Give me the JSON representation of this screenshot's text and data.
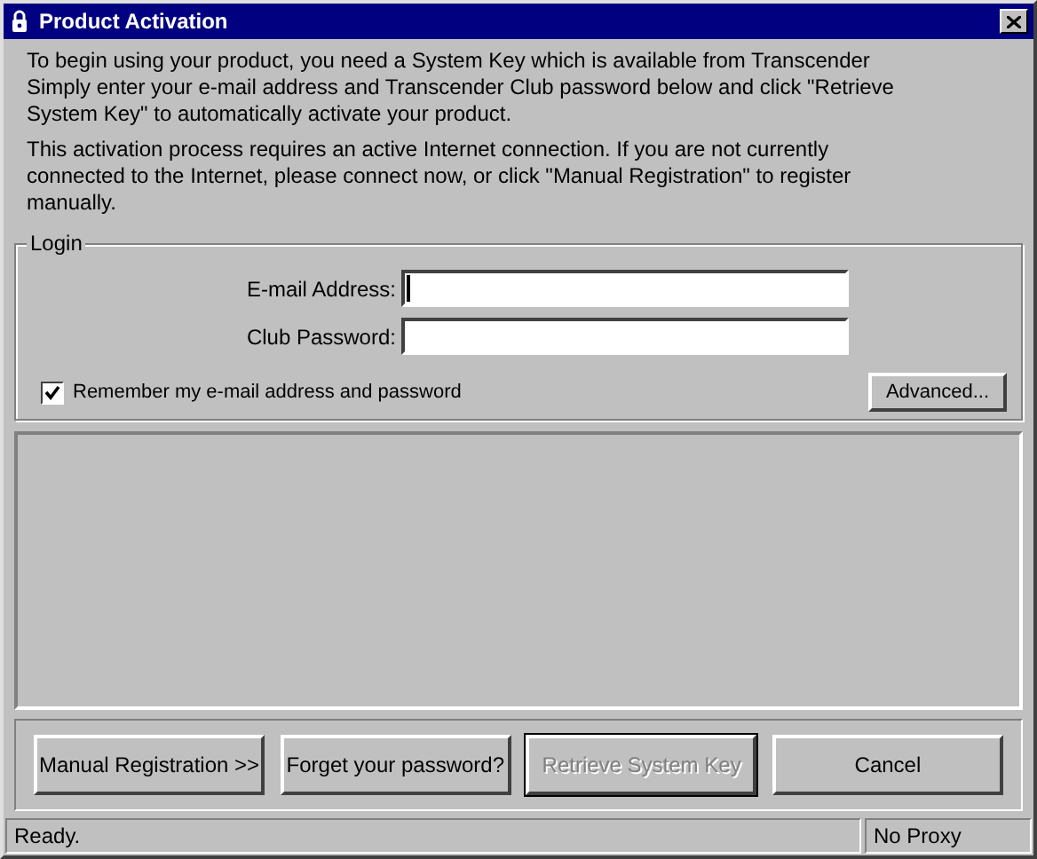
{
  "window": {
    "title": "Product Activation"
  },
  "intro": [
    "To begin using your product, you need a System Key which is available from Transcender\nSimply enter your e-mail address and Transcender Club password below and click \"Retrieve\nSystem Key\"  to automatically activate your product.",
    "This activation process requires an active Internet connection.  If you are not currently\nconnected to the Internet, please connect now, or click \"Manual Registration\" to register\nmanually."
  ],
  "login": {
    "title": "Login",
    "fields": [
      {
        "label": "E-mail Address:",
        "focused": true
      },
      {
        "label": "Club Password:",
        "focused": false
      }
    ],
    "remember": {
      "label": "Remember my e-mail address and password",
      "checked": true
    },
    "advanced_button": "Advanced..."
  },
  "buttons": [
    {
      "label": "Manual Registration >>",
      "disabled": false,
      "default": false
    },
    {
      "label": "Forget your password?",
      "disabled": false,
      "default": false
    },
    {
      "label": "Retrieve System Key",
      "disabled": true,
      "default": true
    },
    {
      "label": "Cancel",
      "disabled": false,
      "default": false
    }
  ],
  "status_bar": {
    "message": "Ready.",
    "proxy": "No Proxy"
  }
}
